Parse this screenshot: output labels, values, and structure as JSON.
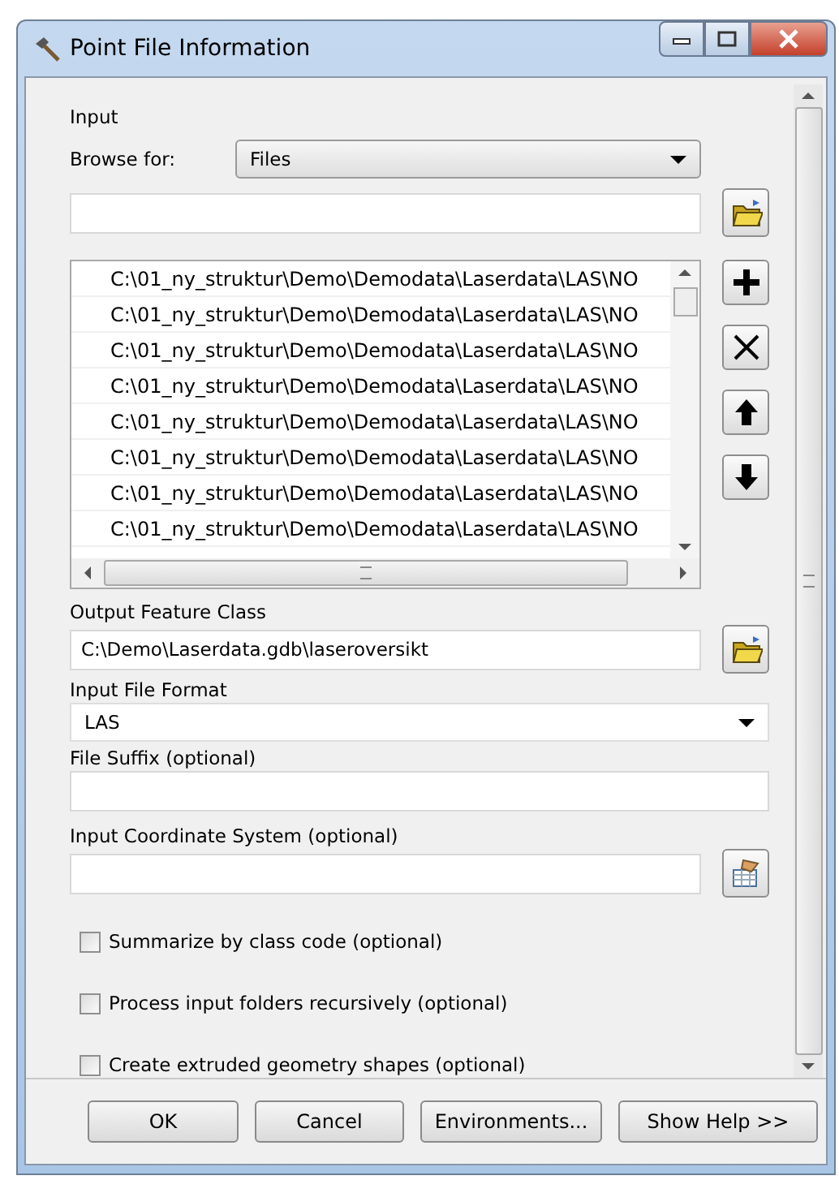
{
  "window": {
    "title": "Point File Information"
  },
  "input": {
    "label": "Input",
    "browse_label": "Browse for:",
    "browse_value": "Files",
    "files": [
      "C:\\01_ny_struktur\\Demo\\Demodata\\Laserdata\\LAS\\NO",
      "C:\\01_ny_struktur\\Demo\\Demodata\\Laserdata\\LAS\\NO",
      "C:\\01_ny_struktur\\Demo\\Demodata\\Laserdata\\LAS\\NO",
      "C:\\01_ny_struktur\\Demo\\Demodata\\Laserdata\\LAS\\NO",
      "C:\\01_ny_struktur\\Demo\\Demodata\\Laserdata\\LAS\\NO",
      "C:\\01_ny_struktur\\Demo\\Demodata\\Laserdata\\LAS\\NO",
      "C:\\01_ny_struktur\\Demo\\Demodata\\Laserdata\\LAS\\NO",
      "C:\\01_ny_struktur\\Demo\\Demodata\\Laserdata\\LAS\\NO"
    ]
  },
  "output_feature_class": {
    "label": "Output Feature Class",
    "value": "C:\\Demo\\Laserdata.gdb\\laseroversikt"
  },
  "input_file_format": {
    "label": "Input File Format",
    "value": "LAS"
  },
  "file_suffix": {
    "label": "File Suffix (optional)"
  },
  "coordinate_system": {
    "label": "Input Coordinate System (optional)"
  },
  "options": [
    {
      "label": "Summarize by class code (optional)",
      "checked": false
    },
    {
      "label": "Process input folders recursively (optional)",
      "checked": false
    },
    {
      "label": "Create extruded geometry shapes (optional)",
      "checked": false
    }
  ],
  "buttons": [
    "OK",
    "Cancel",
    "Environments...",
    "Show Help >>"
  ]
}
